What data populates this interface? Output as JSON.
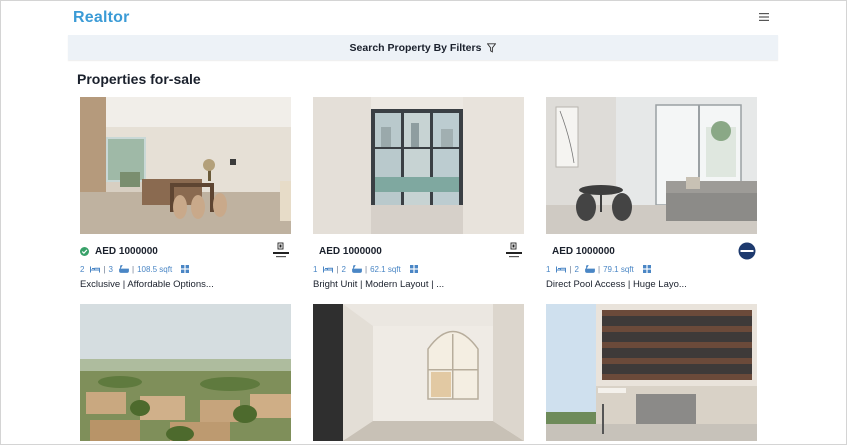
{
  "app": {
    "logo": "Realtor"
  },
  "filters": {
    "label": "Search Property By Filters",
    "icon": "filter-icon"
  },
  "section": {
    "title": "Properties for-sale"
  },
  "listings": [
    {
      "price": "AED 1000000",
      "verified": true,
      "beds": "2",
      "baths": "3",
      "area": "108.5 sqft",
      "title": "Exclusive | Affordable Options...",
      "agency": "driven-logo"
    },
    {
      "price": "AED 1000000",
      "verified": false,
      "beds": "1",
      "baths": "2",
      "area": "62.1 sqft",
      "title": "Bright Unit | Modern Layout | ...",
      "agency": "driven-logo"
    },
    {
      "price": "AED 1000000",
      "verified": false,
      "beds": "1",
      "baths": "2",
      "area": "79.1 sqft",
      "title": "Direct Pool Access | Huge Layo...",
      "agency": "agency-badge-logo"
    },
    {
      "photo": "villa-community-aerial"
    },
    {
      "photo": "empty-room-arched-window"
    },
    {
      "photo": "park-point-building"
    }
  ],
  "colors": {
    "brand": "#3b9bd6",
    "filter_bar": "#edf2f7",
    "feature_icon": "#4a86c5",
    "verified": "#38a169"
  }
}
